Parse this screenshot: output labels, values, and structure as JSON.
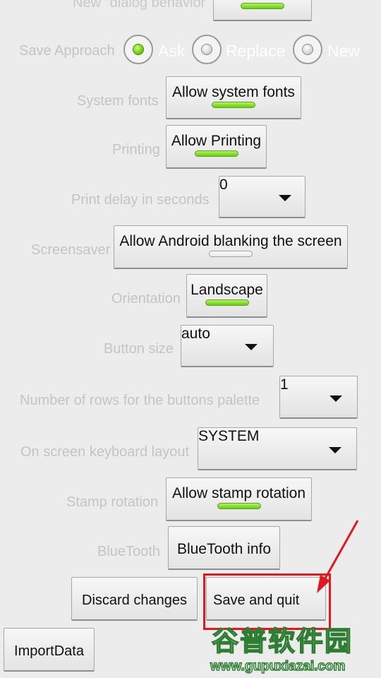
{
  "settings": {
    "new_dialog_label": "New \"dialog behavior",
    "save_approach": {
      "label": "Save Approach",
      "options": [
        "Ask",
        "Replace",
        "New"
      ],
      "selected": "Ask"
    },
    "system_fonts": {
      "label": "System fonts",
      "button": "Allow system fonts",
      "enabled": true
    },
    "printing": {
      "label": "Printing",
      "button": "Allow Printing",
      "enabled": true
    },
    "print_delay": {
      "label": "Print delay in seconds",
      "value": "0"
    },
    "screensaver": {
      "label": "Screensaver",
      "button": "Allow Android blanking the screen",
      "enabled": false
    },
    "orientation": {
      "label": "Orientation",
      "button": "Landscape",
      "enabled": true
    },
    "button_size": {
      "label": "Button size",
      "value": "auto"
    },
    "rows_palette": {
      "label": "Number of rows for the buttons palette",
      "value": "1"
    },
    "keyboard_layout": {
      "label": "On screen keyboard layout",
      "value": "SYSTEM"
    },
    "stamp_rotation": {
      "label": "Stamp rotation",
      "button": "Allow stamp rotation",
      "enabled": true
    },
    "bluetooth": {
      "label": "BlueTooth",
      "button": "BlueTooth info"
    }
  },
  "actions": {
    "discard": "Discard changes",
    "save_quit": "Save and quit",
    "import": "ImportData"
  },
  "watermark": {
    "chinese": "谷普软件园",
    "url": "www.gupuxiazai.com"
  },
  "colors": {
    "toggle_on": "#6ad600",
    "annotation_red": "#e0191f",
    "label_gray": "#c4c4c4"
  }
}
